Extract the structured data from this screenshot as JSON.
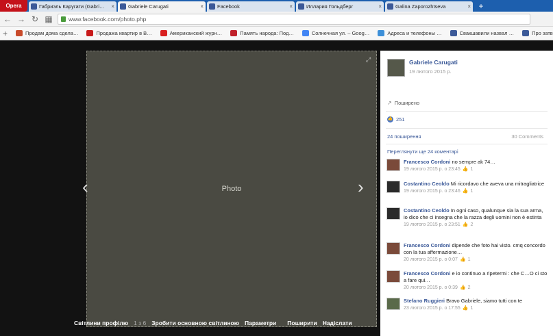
{
  "browser": {
    "menu_label": "Opera",
    "tabs": [
      {
        "label": "Габриэль Каругати (Gabri…",
        "active": false
      },
      {
        "label": "Gabriele Carugati",
        "active": true
      },
      {
        "label": "Facebook",
        "active": false
      },
      {
        "label": "Иллария Гольдберг",
        "active": false
      },
      {
        "label": "Galina Zaporozhtseva",
        "active": false
      }
    ],
    "new_tab_label": "+",
    "url": "www.facebook.com/photo.php",
    "bookmarks": [
      {
        "label": "Продам дома сдела…",
        "color": "#c84a2a"
      },
      {
        "label": "Продажа квартир в В…",
        "color": "#c81a1a"
      },
      {
        "label": "Американский журн…",
        "color": "#d92020"
      },
      {
        "label": "Память народа: Под…",
        "color": "#c0202a"
      },
      {
        "label": "Солнечная ул. – Goog…",
        "color": "#4285f4"
      },
      {
        "label": "Адреса и телефоны …",
        "color": "#3c8fd8"
      },
      {
        "label": "Свакшавили назвал …",
        "color": "#3b5998"
      },
      {
        "label": "Про затвер…",
        "color": "#3b5998"
      }
    ]
  },
  "viewer": {
    "photo_placeholder": "Photo",
    "footer": {
      "profile_photos": "Світлини профілю",
      "counter": "1 з 6",
      "make_profile": "Зробити основною світлиною",
      "options": "Параметри",
      "share": "Поширити",
      "send": "Надіслати"
    }
  },
  "panel": {
    "author": "Gabriele Carugati",
    "date": "19 лютого 2015 р.",
    "share_label": "Поширено",
    "likes": "251",
    "shares": "24 поширення",
    "comments_count": "30 Comments",
    "more_comments": "Переглянути ще 24 коментарі",
    "comments": [
      {
        "author": "Francesco Cordoni",
        "text": "no sempre ak 74…",
        "date": "19 лютого 2015 р. о 23:45",
        "likes": "1"
      },
      {
        "author": "Costantino Ceoldo",
        "text": "Mi ricordavo che aveva una mitragliatrice",
        "date": "19 лютого 2015 р. о 23:46",
        "likes": "1"
      },
      {
        "author": "Costantino Ceoldo",
        "text": "In ogni caso, qualunque sia la sua arma, io dico che ci insegna che la razza degli uomini non è estinta",
        "date": "19 лютого 2015 р. о 23:51",
        "likes": "2"
      },
      {
        "author": "Francesco Cordoni",
        "text": "dipende che foto hai visto. cmq concordo con la tua affermazione…",
        "date": "20 лютого 2015 р. о 0:07",
        "likes": "1"
      },
      {
        "author": "Francesco Cordoni",
        "text": "e io continuo a ripetermi : che C…O ci sto a fare qui…",
        "date": "20 лютого 2015 р. о 0:39",
        "likes": "2"
      },
      {
        "author": "Stefano Ruggieri",
        "text": "Bravo Gabriele, siamo tutti con te",
        "date": "23 лютого 2015 р. о 17:55",
        "likes": "1"
      }
    ]
  }
}
